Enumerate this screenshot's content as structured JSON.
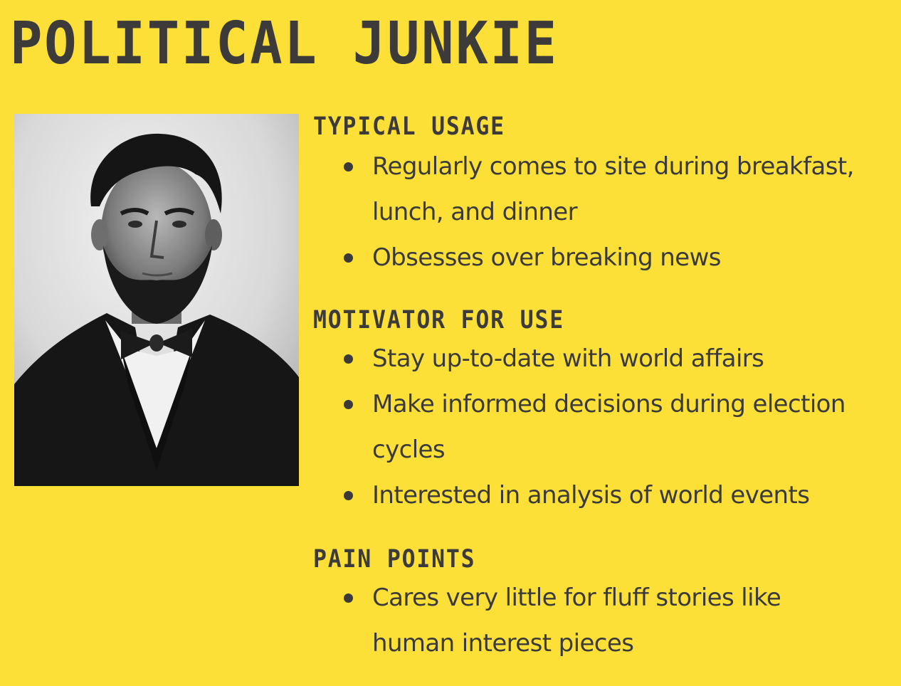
{
  "title": "POLITICAL JUNKIE",
  "portrait": {
    "alt": "Black and white portrait photograph of a bearded man in a dark suit and bow tie"
  },
  "sections": [
    {
      "heading": "TYPICAL USAGE",
      "items": [
        "Regularly comes to site during breakfast, lunch, and dinner",
        "Obsesses over breaking news"
      ]
    },
    {
      "heading": "MOTIVATOR FOR USE",
      "items": [
        "Stay up-to-date with world affairs",
        "Make informed decisions during election cycles",
        "Interested in analysis of world events"
      ]
    },
    {
      "heading": "PAIN POINTS",
      "items": [
        "Cares very little for fluff stories like human interest pieces"
      ]
    }
  ],
  "colors": {
    "background": "#fde037",
    "text": "#3a3a3a"
  }
}
